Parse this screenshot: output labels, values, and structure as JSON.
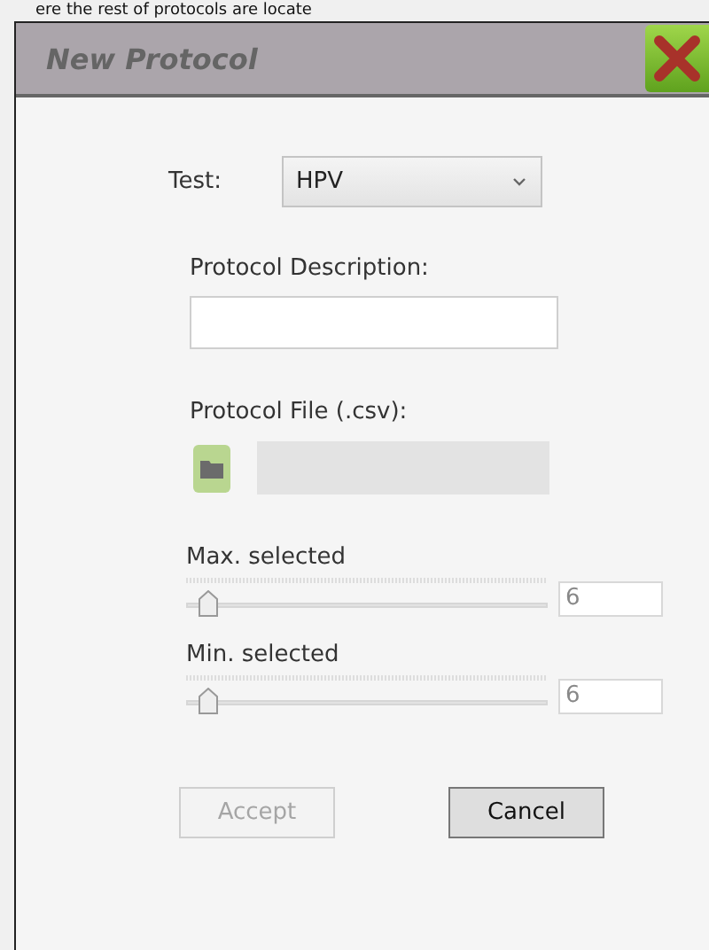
{
  "background_text": "ere the rest of protocols are locate",
  "window": {
    "title": "New Protocol"
  },
  "test": {
    "label": "Test:",
    "value": "HPV"
  },
  "description": {
    "label": "Protocol Description:"
  },
  "file": {
    "label": "Protocol File (.csv):"
  },
  "sliders": [
    {
      "label": "Max. selected",
      "level": 0.06,
      "reading": "6"
    },
    {
      "label": "Min. selected",
      "level": 0.06,
      "reading": "6"
    }
  ],
  "buttons": [
    {
      "label": "Accept",
      "disabled": true
    },
    {
      "label": "Cancel",
      "disabled": false
    }
  ]
}
